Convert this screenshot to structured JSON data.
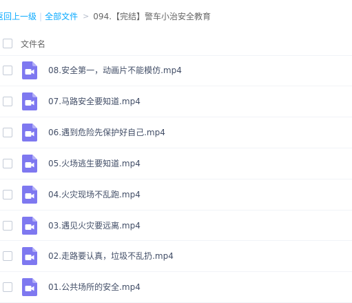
{
  "breadcrumb": {
    "back": "返回上一级",
    "bar": "|",
    "all_files": "全部文件",
    "arrow": ">",
    "current": "094.【完结】警车小治安全教育"
  },
  "list": {
    "header": "文件名",
    "icon": "video-file-icon",
    "icon_color": "#7e78f0",
    "files": [
      {
        "name": "08.安全第一，动画片不能模仿.mp4"
      },
      {
        "name": "07.马路安全要知道.mp4"
      },
      {
        "name": "06.遇到危险先保护好自己.mp4"
      },
      {
        "name": "05.火场逃生要知道.mp4"
      },
      {
        "name": "04.火灾现场不乱跑.mp4"
      },
      {
        "name": "03.遇见火灾要远离.mp4"
      },
      {
        "name": "02.走路要认真，垃圾不乱扔.mp4"
      },
      {
        "name": "01.公共场所的安全.mp4"
      }
    ]
  }
}
